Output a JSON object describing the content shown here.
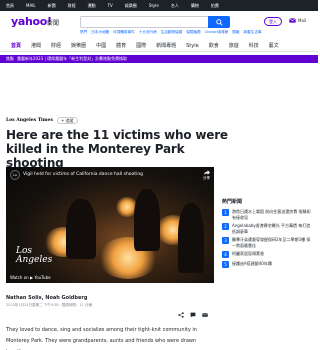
{
  "topbar": {
    "items": [
      "首頁",
      "MAIL",
      "新聞",
      "財經",
      "運動",
      "TV",
      "娛樂圈",
      "Style",
      "名人",
      "購物",
      "拍賣"
    ]
  },
  "header": {
    "logo": "yahoo!",
    "logo_sub": "新聞",
    "search_placeholder": "",
    "login_label": "登入",
    "mail_label": "Mail"
  },
  "subnav": {
    "items": [
      "熱門",
      "日本大地震",
      "坪頂體育事件",
      "十大流行病",
      "生活動物保護",
      "保險議題",
      "Charon咖啡館",
      "閱報",
      "新春生活事"
    ]
  },
  "mainnav": {
    "items": [
      {
        "label": "首頁",
        "active": true
      },
      {
        "label": "港聞",
        "active": false
      },
      {
        "label": "財經",
        "active": false
      },
      {
        "label": "娛樂圈",
        "active": false
      },
      {
        "label": "中國",
        "active": false
      },
      {
        "label": "體育",
        "active": false
      },
      {
        "label": "國際",
        "active": false
      },
      {
        "label": "新聞專題",
        "active": false
      },
      {
        "label": "Style",
        "active": false
      },
      {
        "label": "飲食",
        "active": false
      },
      {
        "label": "旅遊",
        "active": false
      },
      {
        "label": "科技",
        "active": false
      },
      {
        "label": "藝文",
        "active": false
      }
    ]
  },
  "breaking": {
    "tag": "焦點",
    "text": "農曆新年2023 | 環保農曆年「新生利是封」計劃地點免費換取"
  },
  "article": {
    "source": "Los Angeles Times",
    "follow_label": "+ 追蹤",
    "headline": "Here are the 11 victims who were killed in the Monterey Park shooting",
    "video_title": "Vigil held for victims of California dance hall shooting",
    "video_share": "分享",
    "video_logo_line1": "Los",
    "video_logo_line2": "Angeles",
    "video_watch": "Watch on ▶ YouTube",
    "authors": "Nathan Solis, Noah Goldberg",
    "dateline": "2023年1月24日星期二 下午4:38 · 閱讀時間：11 分鐘",
    "body": "They loved to dance, sing and socialize among their tight-knit community in Monterey Park. They were grandparents, aunts and friends who were drawn together"
  },
  "trending": {
    "title": "熱門新聞",
    "items": [
      {
        "num": "1",
        "text": "港首日遭水上樂園 前向住客送還房費 指稱如有接收見"
      },
      {
        "num": "2",
        "text": "Angelababy香港賽宅曝光 平方萬價 每打造低調豪華"
      },
      {
        "num": "3",
        "text": "醫專牙弟遭督導發掘保研2年至二學期3樓 採一幣面最靠佳"
      },
      {
        "num": "4",
        "text": "柯麗家居容傳素香"
      },
      {
        "num": "5",
        "text": "接踵迪A搭建銀40年蹟"
      }
    ]
  },
  "colors": {
    "brand": "#6001d2",
    "accent": "#0f69ff",
    "topbar": "#1d2228"
  }
}
